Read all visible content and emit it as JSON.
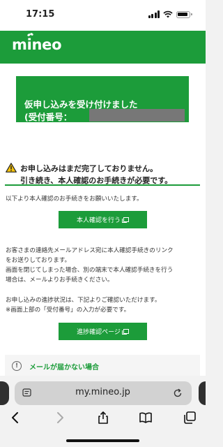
{
  "status_bar": {
    "time": "17:15"
  },
  "header": {
    "logo_text": "mineo"
  },
  "notice_box": {
    "line1": "仮申し込みを受け付けました",
    "line2": "(受付番号："
  },
  "warning": {
    "line1": "お申し込みはまだ完了しておりません。",
    "line2": "引き続き、本人確認のお手続きが必要です。"
  },
  "intro_text": "以下より本人確認のお手続きをお願いいたします。",
  "identity_button": {
    "label": "本人確認を行う"
  },
  "email_notice": [
    "お客さまの連絡先メールアドレス宛に本人確認手続きのリンク",
    "をお送りしております。",
    "画面を閉じてしまった場合、別の端末で本人確認手続きを行う",
    "場合は、メールよりお手続きください。"
  ],
  "progress_notice": [
    "お申し込みの進捗状況は、下記よりご確認いただけます。",
    "※画面上部の「受付番号」の入力が必要です。"
  ],
  "progress_button": {
    "label": "進捗確認ページ"
  },
  "mail_card": {
    "label": "メールが届かない場合",
    "icon": "!"
  },
  "browser": {
    "url": "my.mineo.jp"
  },
  "colors": {
    "brand_green": "#1c9c3a"
  }
}
